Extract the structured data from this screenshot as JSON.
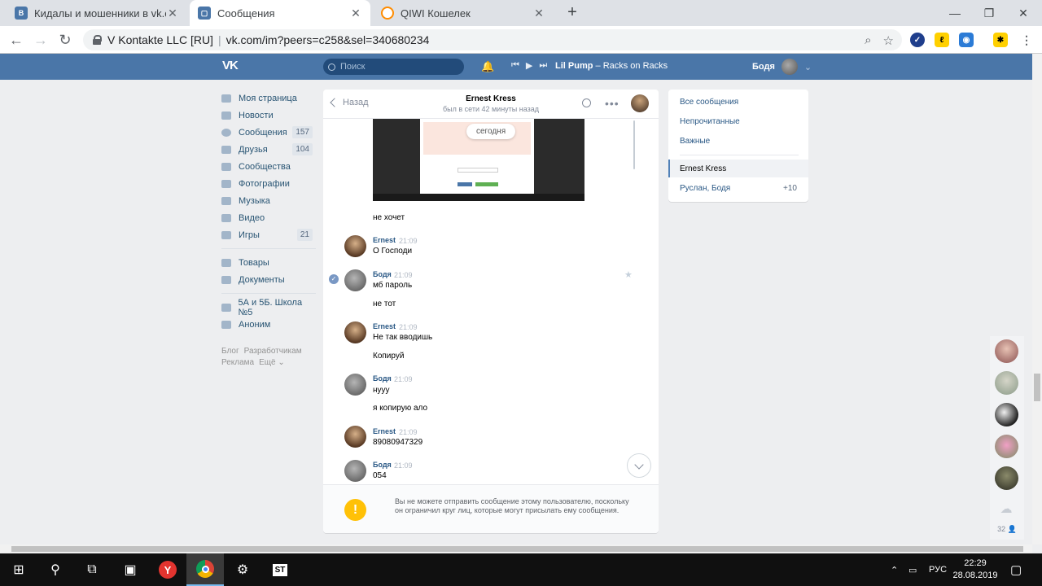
{
  "browser": {
    "tabs": [
      {
        "title": "Кидалы и мошенники в vk.com",
        "favicon_color": "#4a76a8",
        "active": false
      },
      {
        "title": "Сообщения",
        "favicon_color": "#4a76a8",
        "active": true
      },
      {
        "title": "QIWI Кошелек",
        "favicon_color": "#ff8c00",
        "active": false
      }
    ],
    "new_tab_label": "+",
    "window_controls": {
      "minimize": "—",
      "maximize": "❐",
      "close": "✕"
    },
    "address": {
      "org": "V Kontakte LLC [RU]",
      "separator": "|",
      "url": "vk.com/im?peers=c258&sel=340680234"
    }
  },
  "vk_header": {
    "logo": "VK",
    "search_placeholder": "Поиск",
    "track_artist": "Lil Pump",
    "track_dash": " – ",
    "track_title": "Racks on Racks",
    "user_name": "Бодя"
  },
  "left_nav": {
    "items": [
      {
        "label": "Моя страница",
        "count": ""
      },
      {
        "label": "Новости",
        "count": ""
      },
      {
        "label": "Сообщения",
        "count": "157"
      },
      {
        "label": "Друзья",
        "count": "104"
      },
      {
        "label": "Сообщества",
        "count": ""
      },
      {
        "label": "Фотографии",
        "count": ""
      },
      {
        "label": "Музыка",
        "count": ""
      },
      {
        "label": "Видео",
        "count": ""
      },
      {
        "label": "Игры",
        "count": "21"
      }
    ],
    "items2": [
      {
        "label": "Товары"
      },
      {
        "label": "Документы"
      }
    ],
    "items3": [
      {
        "label": "5А и 5Б. Школа №5"
      },
      {
        "label": "Аноним"
      }
    ],
    "footer": {
      "blog": "Блог",
      "dev": "Разработчикам",
      "ads": "Реклама",
      "more": "Ещё ⌄"
    }
  },
  "chat": {
    "back_label": "Назад",
    "peer_name": "Ernest Kress",
    "peer_status": "был в сети 42 минуты назад",
    "date_pill": "сегодня",
    "messages": [
      {
        "text": "не хочет"
      },
      {
        "author": "Ernest",
        "time": "21:09",
        "text": "О Господи"
      },
      {
        "author": "Бодя",
        "time": "21:09",
        "text": "мб пароль",
        "text2": "не тот"
      },
      {
        "author": "Ernest",
        "time": "21:09",
        "text": "Не так вводишь",
        "text2": "Копируй"
      },
      {
        "author": "Бодя",
        "time": "21:09",
        "text": "нууу",
        "text2": "я копирую ало"
      },
      {
        "author": "Ernest",
        "time": "21:09",
        "text": "89080947329"
      },
      {
        "author": "Бодя",
        "time": "21:09",
        "text": "054"
      }
    ],
    "notice": "Вы не можете отправить сообщение этому пользователю, поскольку он ограничил круг лиц, которые могут присылать ему сообщения.",
    "warn_symbol": "!"
  },
  "right_panel": {
    "filters": [
      "Все сообщения",
      "Непрочитанные",
      "Важные"
    ],
    "conversations": [
      {
        "name": "Ernest Kress",
        "count": ""
      },
      {
        "name": "Руслан, Бодя",
        "count": "+10"
      }
    ]
  },
  "rail": {
    "count": "32 👤"
  },
  "taskbar": {
    "lang": "РУС",
    "time": "22:29",
    "date": "28.08.2019",
    "st_label": "ST"
  }
}
